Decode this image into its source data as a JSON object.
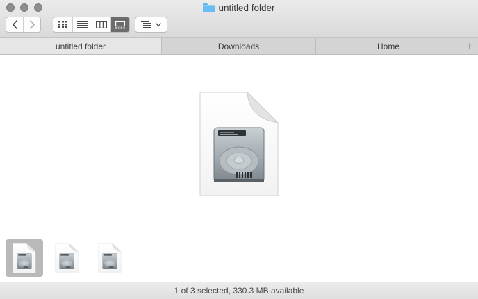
{
  "window": {
    "title": "untitled folder"
  },
  "toolbar": {
    "back_icon": "chevron-left-icon",
    "forward_icon": "chevron-right-icon",
    "view_modes": [
      "icon-view",
      "list-view",
      "column-view",
      "gallery-view"
    ],
    "active_view": "gallery-view",
    "group_by_icon": "group-by-icon"
  },
  "tabs": [
    {
      "label": "untitled folder",
      "active": true
    },
    {
      "label": "Downloads",
      "active": false
    },
    {
      "label": "Home",
      "active": false
    }
  ],
  "gallery": {
    "preview_icon": "disk-image-icon",
    "thumbnails": [
      {
        "icon": "disk-image-icon",
        "selected": true
      },
      {
        "icon": "disk-image-icon",
        "selected": false
      },
      {
        "icon": "disk-image-icon",
        "selected": false
      }
    ]
  },
  "status": {
    "text": "1 of 3 selected, 330.3 MB available"
  },
  "colors": {
    "folder": "#68bdf3",
    "selection": "#b9b9b9",
    "active_view_button": "#6c6c6c"
  }
}
